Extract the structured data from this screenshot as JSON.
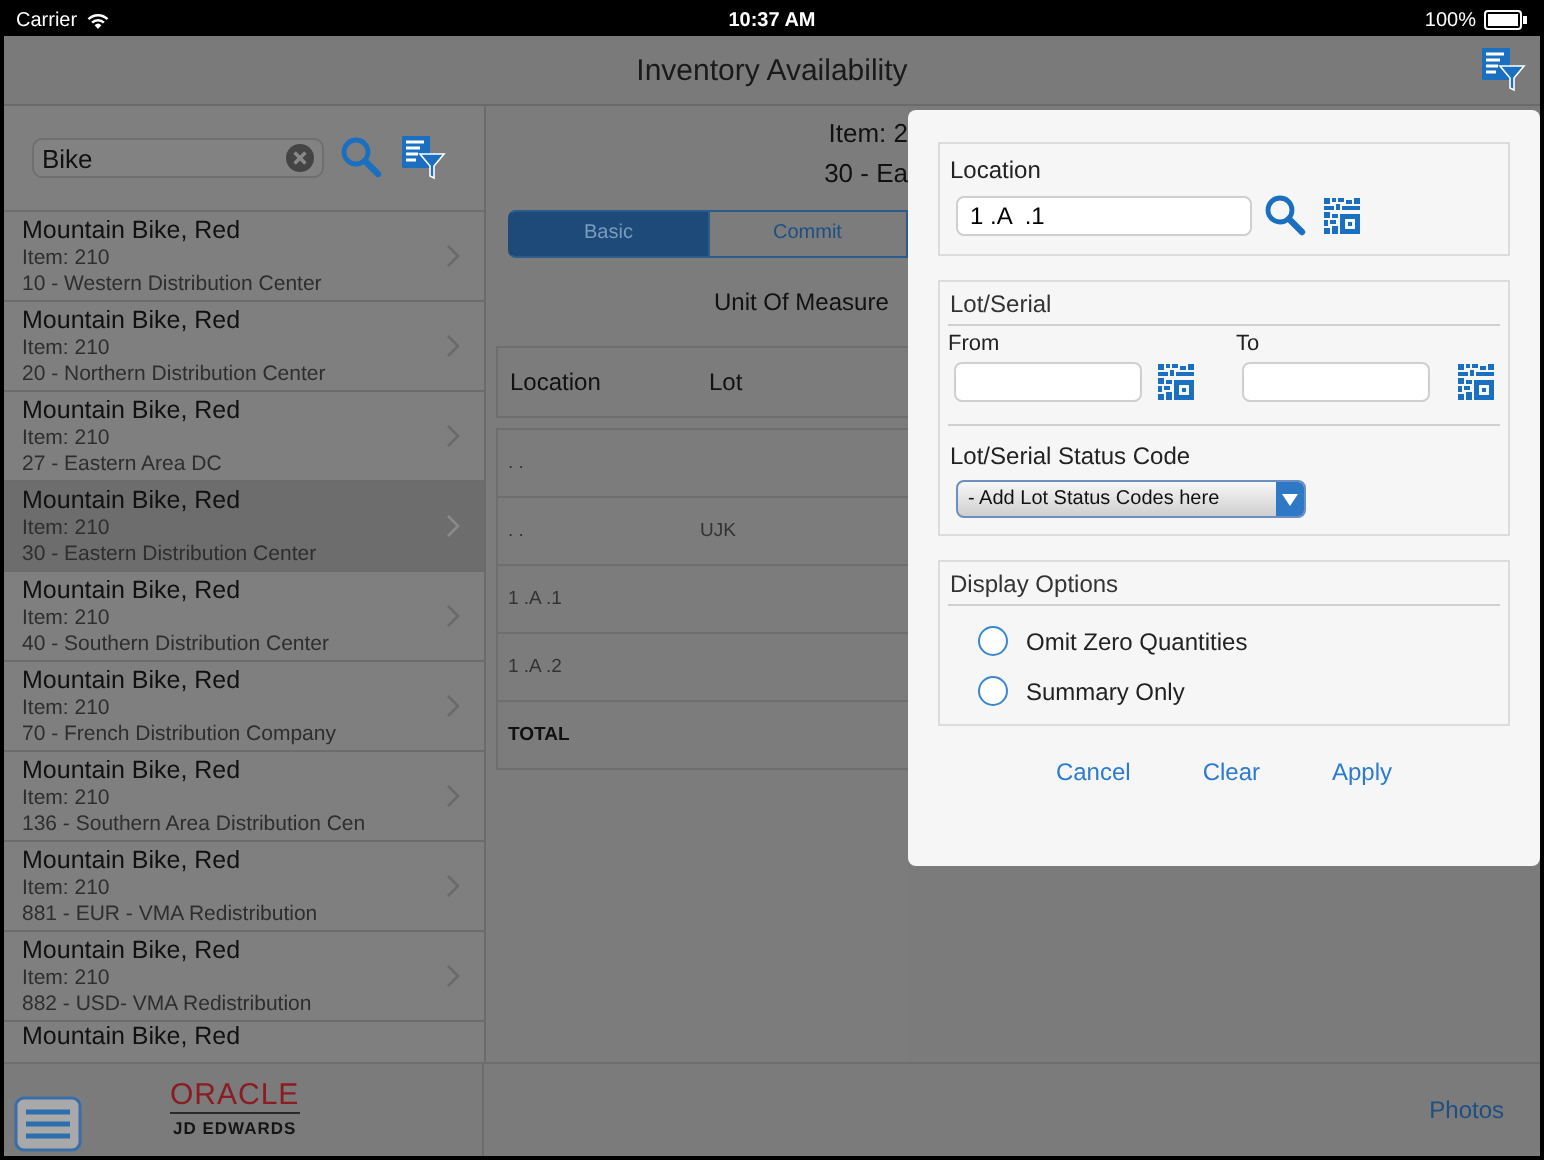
{
  "status_bar": {
    "carrier": "Carrier",
    "time": "10:37 AM",
    "battery": "100%"
  },
  "header": {
    "title": "Inventory Availability"
  },
  "search": {
    "value": "Bike"
  },
  "results": [
    {
      "name": "Mountain Bike, Red",
      "item": "Item: 210",
      "branch": "10 - Western Distribution Center",
      "selected": false
    },
    {
      "name": "Mountain Bike, Red",
      "item": "Item: 210",
      "branch": "20 - Northern Distribution Center",
      "selected": false
    },
    {
      "name": "Mountain Bike, Red",
      "item": "Item: 210",
      "branch": "27 - Eastern Area DC",
      "selected": false
    },
    {
      "name": "Mountain Bike, Red",
      "item": "Item: 210",
      "branch": "30 - Eastern Distribution Center",
      "selected": true
    },
    {
      "name": "Mountain Bike, Red",
      "item": "Item: 210",
      "branch": "40 - Southern Distribution Center",
      "selected": false
    },
    {
      "name": "Mountain Bike, Red",
      "item": "Item: 210",
      "branch": "70 - French Distribution Company",
      "selected": false
    },
    {
      "name": "Mountain Bike, Red",
      "item": "Item: 210",
      "branch": "136 - Southern Area Distribution Cen",
      "selected": false
    },
    {
      "name": "Mountain Bike, Red",
      "item": "Item: 210",
      "branch": "881 - EUR - VMA Redistribution",
      "selected": false
    },
    {
      "name": "Mountain Bike, Red",
      "item": "Item: 210",
      "branch": "882 - USD- VMA Redistribution",
      "selected": false
    },
    {
      "name": "Mountain Bike, Red",
      "selected": false
    }
  ],
  "detail": {
    "item": "Item: 2",
    "branch": "30 - Ea",
    "tabs": [
      {
        "label": "Basic",
        "selected": true
      },
      {
        "label": "Commit",
        "selected": false
      }
    ],
    "uom_label": "Unit Of Measure",
    "table": {
      "columns": [
        "Location",
        "Lot"
      ],
      "rows": [
        {
          "kind": "line",
          "location": ". ."
        },
        {
          "kind": "line",
          "location": ". .",
          "lot": "UJK"
        },
        {
          "kind": "line",
          "location": "1 .A .1"
        },
        {
          "kind": "line",
          "location": "1 .A .2"
        },
        {
          "kind": "total",
          "location": "TOTAL"
        }
      ]
    }
  },
  "filter_popup": {
    "location": {
      "label": "Location",
      "value": "1 .A  .1"
    },
    "lot_serial": {
      "heading": "Lot/Serial",
      "from_label": "From",
      "to_label": "To",
      "status_label": "Lot/Serial Status Code",
      "status_select": "- Add Lot Status Codes here"
    },
    "display_options": {
      "heading": "Display Options",
      "options": [
        {
          "label": "Omit Zero Quantities",
          "checked": false
        },
        {
          "label": "Summary Only",
          "checked": false
        }
      ]
    },
    "buttons": [
      "Cancel",
      "Clear",
      "Apply"
    ]
  },
  "footer": {
    "logo": "ORACLE",
    "logo_sub": "JD EDWARDS",
    "photos": "Photos"
  }
}
